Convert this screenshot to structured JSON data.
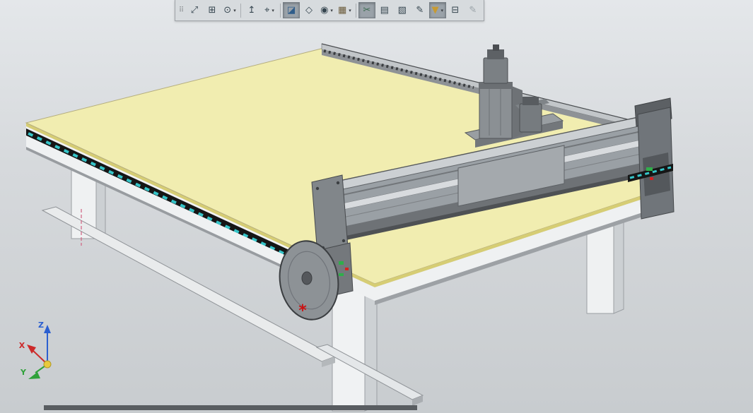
{
  "toolbar": {
    "items": [
      {
        "name": "toolbar-grip",
        "glyph": "⠿",
        "grip": true
      },
      {
        "name": "zoom-to-fit-button",
        "glyph": "⤢"
      },
      {
        "name": "zoom-to-area-button",
        "glyph": "⊞"
      },
      {
        "name": "magnify-button",
        "glyph": "⊙",
        "dropdown": true
      },
      {
        "sep": true
      },
      {
        "name": "previous-view-button",
        "glyph": "↥"
      },
      {
        "name": "view-orientation-button",
        "glyph": "⌖",
        "dropdown": true
      },
      {
        "sep": true
      },
      {
        "name": "display-style-button",
        "glyph": "◪",
        "active": true,
        "color": "#2f5d8a"
      },
      {
        "name": "wireframe-display-button",
        "glyph": "◇"
      },
      {
        "name": "hide-show-items-button",
        "glyph": "◉",
        "dropdown": true
      },
      {
        "name": "apply-scene-button",
        "glyph": "▦",
        "dropdown": true,
        "color": "#6b5b3a"
      },
      {
        "sep": true
      },
      {
        "name": "section-view-button",
        "glyph": "✂",
        "active": true,
        "color": "#3a6b4f"
      },
      {
        "name": "annotations-button",
        "glyph": "▤"
      },
      {
        "name": "markup-button",
        "glyph": "▧"
      },
      {
        "name": "comments-button",
        "glyph": "✎"
      },
      {
        "name": "selection-filter-button",
        "glyph": "▼",
        "active": true,
        "dropdown": true,
        "color": "#c79a32"
      },
      {
        "name": "evaluate-button",
        "glyph": "⊟"
      },
      {
        "name": "edit-sketch-button",
        "glyph": "✎",
        "disabled": true
      }
    ]
  },
  "triad": {
    "x_label": "X",
    "y_label": "Y",
    "z_label": "Z",
    "x_color": "#cc2a2a",
    "y_color": "#2fa13a",
    "z_color": "#2b5fd0",
    "origin_color": "#e9c93b"
  },
  "model": {
    "colors": {
      "table_top": "#f1edb0",
      "table_edge": "#d6cd74",
      "rail_black": "#161616",
      "rail_cyan": "#35c4c8",
      "indicator_green": "#2fae4a",
      "indicator_red": "#d42222"
    },
    "marker": {
      "glyph": "*",
      "color": "#cc1111"
    }
  }
}
